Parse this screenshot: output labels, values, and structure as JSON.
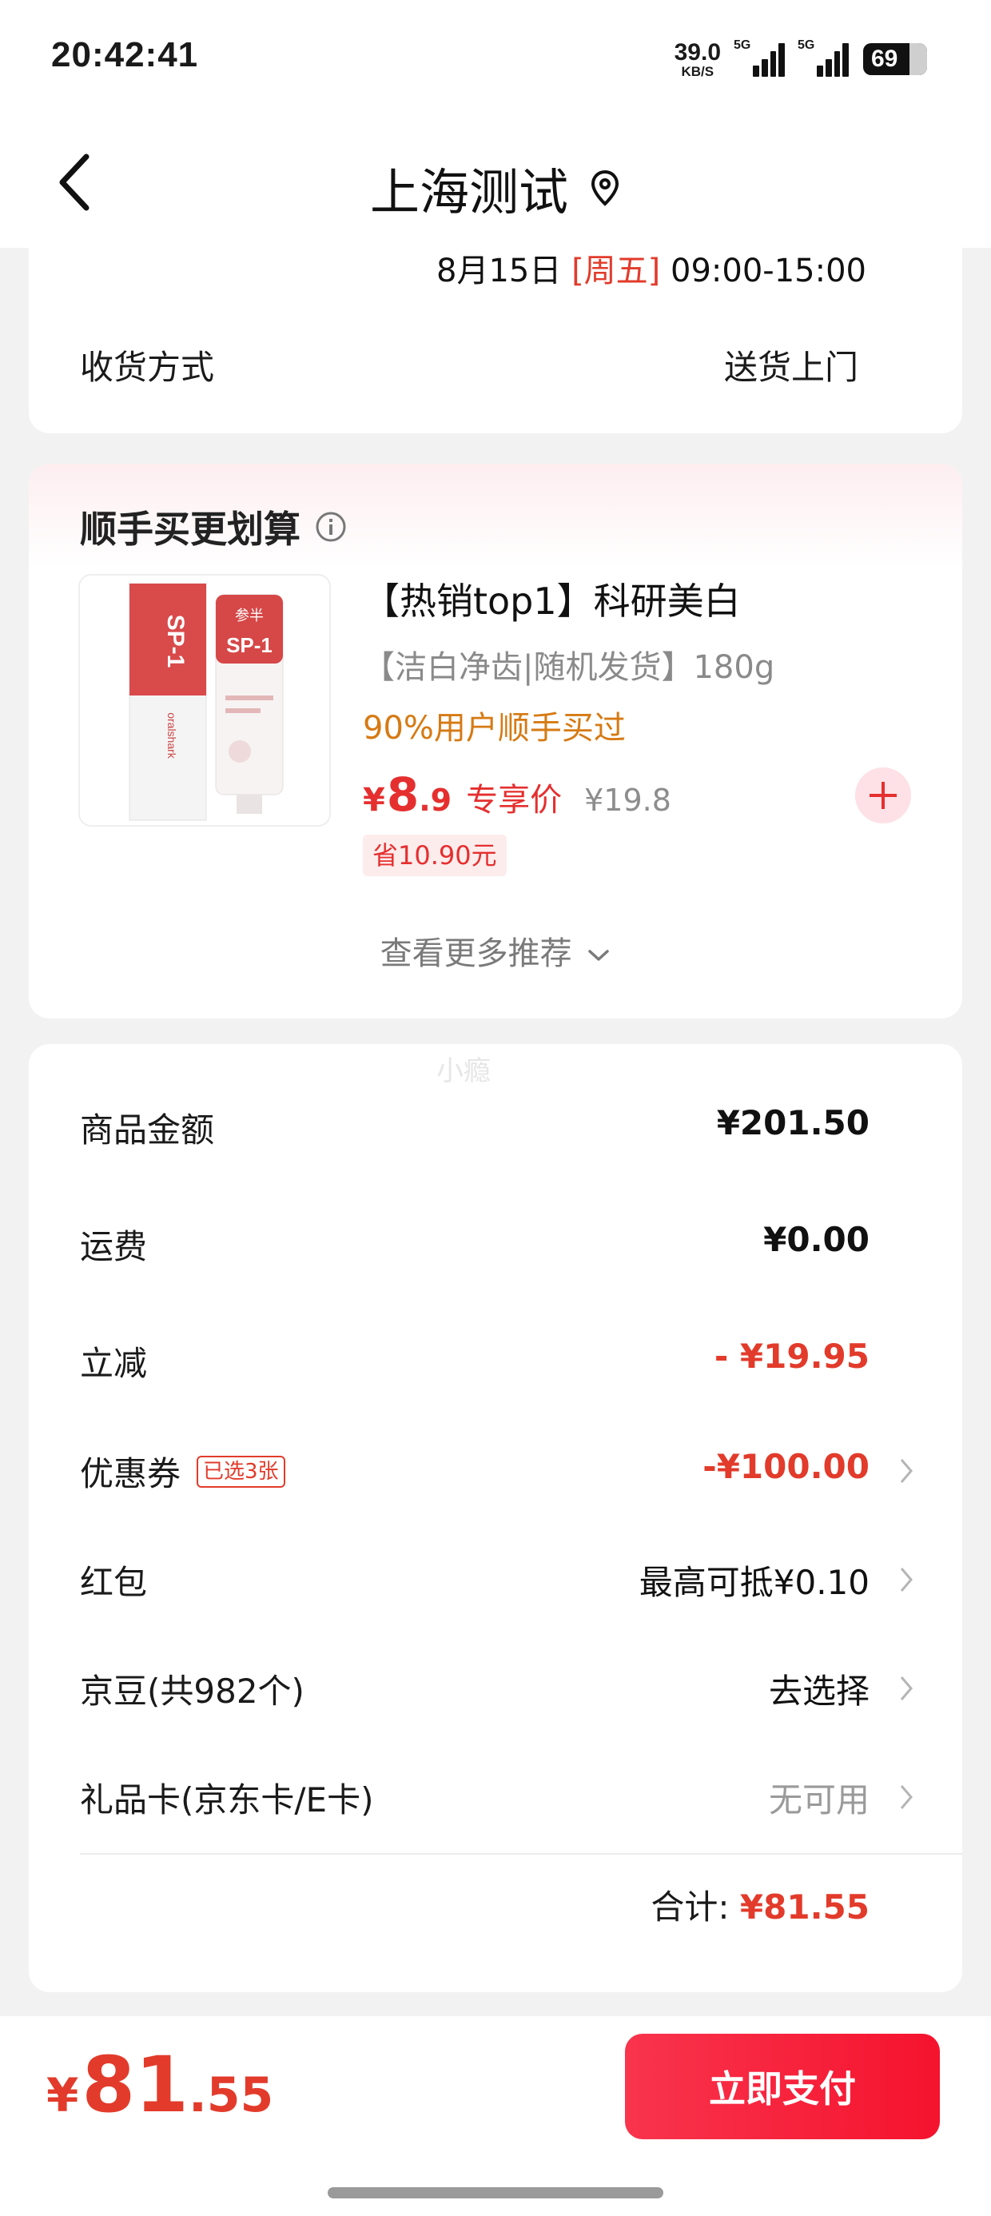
{
  "status_bar": {
    "time": "20:42:41",
    "net_speed_value": "39.0",
    "net_speed_unit": "KB/S",
    "signal1_tag": "5G",
    "signal2_tag": "5G",
    "battery": "69"
  },
  "nav": {
    "title": "上海测试",
    "back_icon": "chevron-left-icon",
    "location_icon": "location-pin-icon"
  },
  "delivery": {
    "date": "8月15日",
    "weekday": "[周五]",
    "time_range": "09:00-15:00",
    "method_label": "收货方式",
    "method_value": "送货上门"
  },
  "recommend": {
    "title": "顺手买更划算",
    "product": {
      "title": "【热销top1】科研美白",
      "subtitle": "【洁白净齿|随机发货】180g",
      "popularity": "90%用户顺手买过",
      "price_currency": "¥",
      "price_int": "8",
      "price_dec": ".9",
      "price_tag": "专享价",
      "original_price": "¥19.8",
      "save_badge": "省10.90元",
      "image_brand": "参半",
      "image_model": "SP-1"
    },
    "more_label": "查看更多推荐"
  },
  "summary": {
    "watermark": "小瘾",
    "rows": [
      {
        "label": "商品金额",
        "value": "¥201.50"
      },
      {
        "label": "运费",
        "value": "¥0.00"
      },
      {
        "label": "立减",
        "value": "- ¥19.95"
      },
      {
        "label": "优惠券",
        "badge": "已选3张",
        "value": "-¥100.00"
      },
      {
        "label": "红包",
        "value": "最高可抵¥0.10"
      },
      {
        "label": "京豆(共982个)",
        "value": "去选择"
      },
      {
        "label": "礼品卡(京东卡/E卡)",
        "value": "无可用"
      }
    ],
    "total_label": "合计:",
    "total_value": "¥81.55"
  },
  "bottom_bar": {
    "currency": "¥",
    "total_int": "81",
    "total_dec": ".55",
    "pay_label": "立即支付"
  },
  "colors": {
    "accent_red": "#e23b2b",
    "pay_button": "#f5132e",
    "popularity_orange": "#d67a14"
  }
}
